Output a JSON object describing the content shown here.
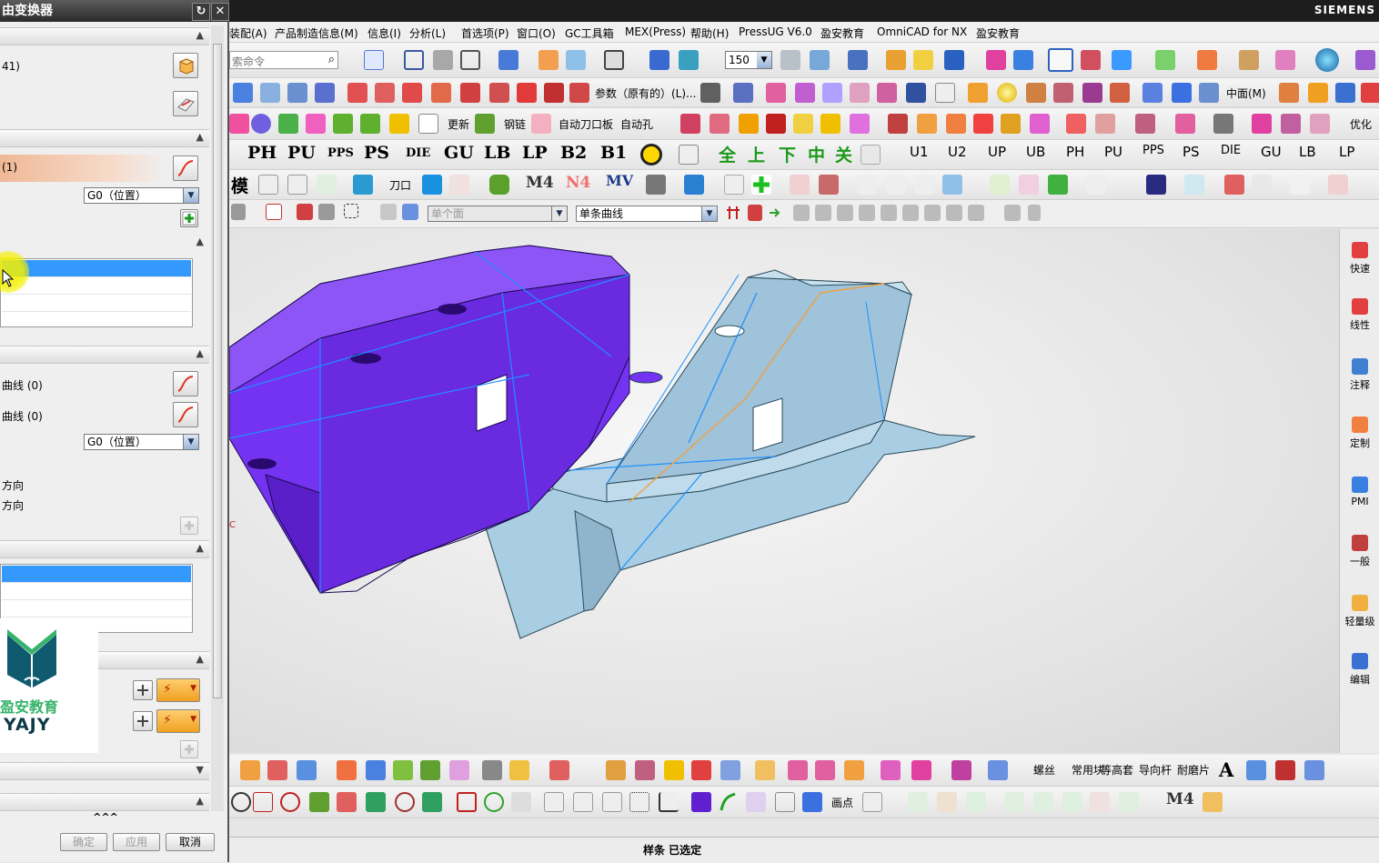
{
  "dialog": {
    "title": "由变换器",
    "sections": {
      "s1_value": "41)",
      "s2_item": "(1)",
      "s2_combo": "G0（位置）",
      "s4_curve1": "曲线 (0)",
      "s4_curve2": "曲线 (0)",
      "s4_combo": "G0（位置）",
      "s4_dir1": "方向",
      "s4_dir2": "方向",
      "more": "^^^"
    },
    "buttons": {
      "ok": "确定",
      "apply": "应用",
      "cancel": "取消"
    }
  },
  "logo": {
    "text_cn": "盈安教育",
    "text_en": "YAJY"
  },
  "window": {
    "brand": "SIEMENS"
  },
  "menu": [
    "装配(A)",
    "产品制造信息(M)",
    "信息(I)",
    "分析(L)",
    "首选项(P)",
    "窗口(O)",
    "GC工具箱",
    "MEX(Press)",
    "帮助(H)",
    "PressUG V6.0",
    "盈安教育",
    "OmniCAD for NX",
    "盈安教育"
  ],
  "toolbar": {
    "command_search_placeholder": "索命令",
    "zoom_value": "150",
    "row2_param_text": "参数（原有的）(L)...",
    "row2_midface": "中面(M)",
    "row3_labels": [
      "更新",
      "钢链",
      "自动刀口板",
      "自动孔",
      "优化"
    ],
    "row4_big": [
      "PH",
      "PU",
      "PPS",
      "PS",
      "DIE",
      "GU",
      "LB",
      "LP",
      "B2",
      "B1"
    ],
    "row4_cn": [
      "全",
      "上",
      "下",
      "中",
      "关"
    ],
    "row4_small": [
      "U1",
      "U2",
      "UP",
      "UB",
      "PH",
      "PU",
      "PPS",
      "PS",
      "DIE",
      "GU",
      "LB",
      "LP"
    ],
    "row5_labels": [
      "模",
      "刀口",
      "M4",
      "N4",
      "MV"
    ],
    "filter_face": "单个面",
    "filter_curve": "单条曲线"
  },
  "bottom_toolbar": {
    "row1_labels": [
      "螺丝",
      "常用块",
      "等高套",
      "导向杆",
      "耐磨片",
      "A"
    ],
    "row2_labels": [
      "画点",
      "M4"
    ]
  },
  "resource_bar": [
    "快速",
    "线性",
    "注释",
    "定制",
    "PMI",
    "一般",
    "轻量级",
    "编辑"
  ],
  "status": {
    "text": "样条 已选定"
  },
  "colors": {
    "part_purple": "#7433f0",
    "part_blue": "#a9cde2",
    "edge_blue": "#1e90ff",
    "edge_orange": "#f0a040",
    "selection": "#3399ff"
  }
}
